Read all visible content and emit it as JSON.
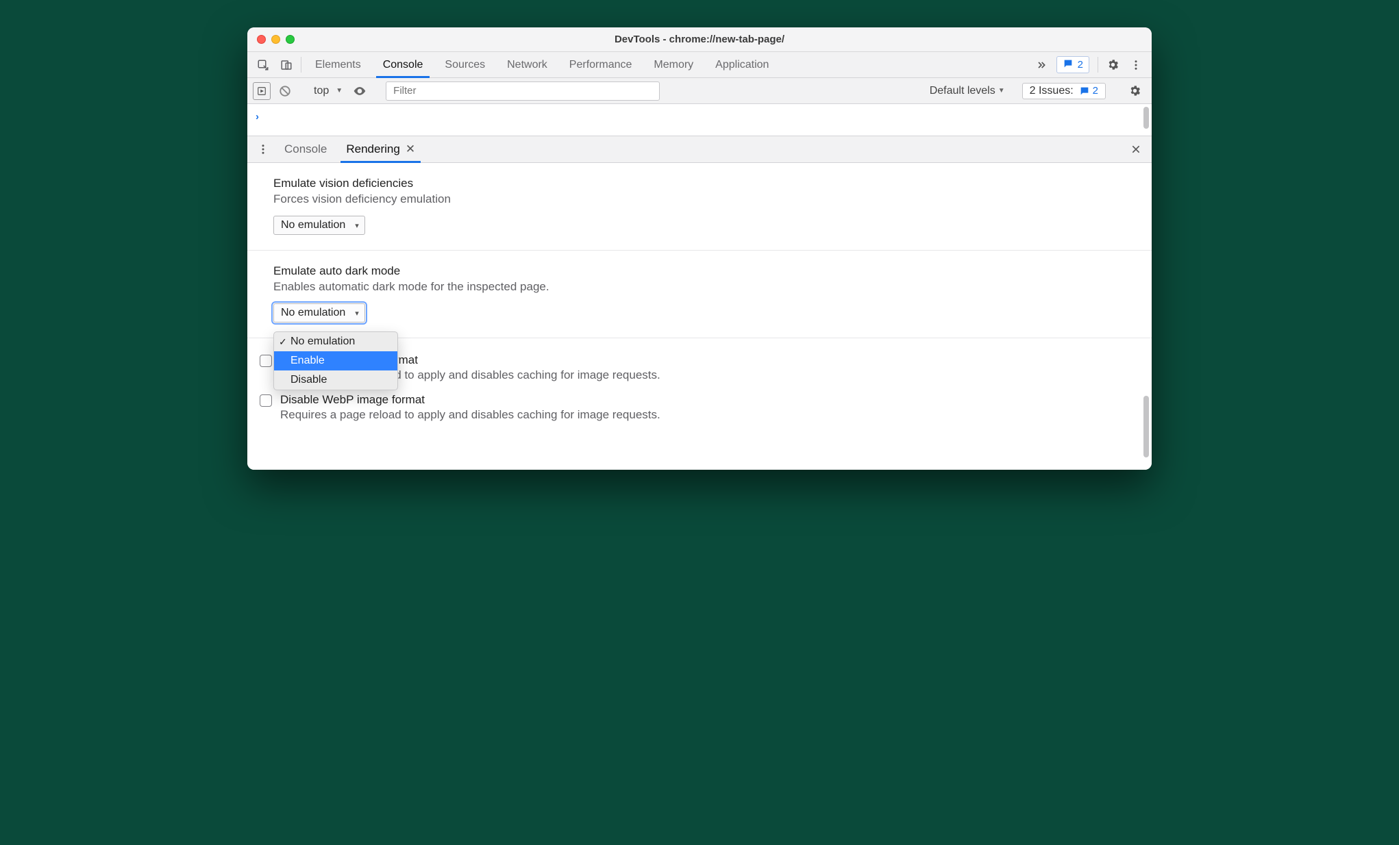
{
  "window": {
    "title": "DevTools - chrome://new-tab-page/"
  },
  "topTabs": {
    "items": [
      "Elements",
      "Console",
      "Sources",
      "Network",
      "Performance",
      "Memory",
      "Application"
    ],
    "active": 1,
    "msgCount": "2"
  },
  "consoleBar": {
    "context": "top",
    "filterPlaceholder": "Filter",
    "levels": "Default levels",
    "issuesLabel": "2 Issues:",
    "issuesCount": "2"
  },
  "drawer": {
    "tabs": [
      "Console",
      "Rendering"
    ],
    "active": 1
  },
  "rendering": {
    "vision": {
      "title": "Emulate vision deficiencies",
      "desc": "Forces vision deficiency emulation",
      "selected": "No emulation"
    },
    "darkmode": {
      "title": "Emulate auto dark mode",
      "desc": "Enables automatic dark mode for the inspected page.",
      "selected": "No emulation",
      "options": [
        "No emulation",
        "Enable",
        "Disable"
      ],
      "highlight": 1
    },
    "avif": {
      "title": "Disable AVIF image format",
      "desc": "Requires a page reload to apply and disables caching for image requests."
    },
    "webp": {
      "title": "Disable WebP image format",
      "desc": "Requires a page reload to apply and disables caching for image requests."
    }
  }
}
